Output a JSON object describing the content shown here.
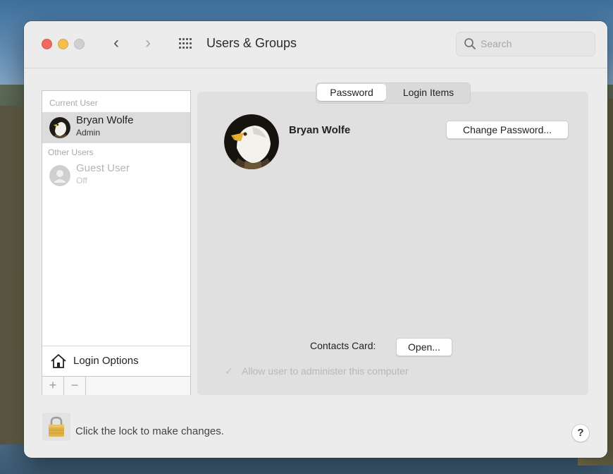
{
  "window": {
    "title": "Users & Groups",
    "search_placeholder": "Search"
  },
  "sidebar": {
    "current_user_label": "Current User",
    "current_user": {
      "name": "Bryan Wolfe",
      "role": "Admin"
    },
    "other_users_label": "Other Users",
    "other_users": [
      {
        "name": "Guest User",
        "role": "Off"
      }
    ],
    "login_options_label": "Login Options",
    "add_label": "+",
    "remove_label": "−"
  },
  "main": {
    "tabs": [
      {
        "label": "Password",
        "active": true
      },
      {
        "label": "Login Items",
        "active": false
      }
    ],
    "profile_name": "Bryan Wolfe",
    "change_password_label": "Change Password...",
    "contacts_card_label": "Contacts Card:",
    "open_label": "Open...",
    "allow_admin_label": "Allow user to administer this computer",
    "allow_admin_checked": true
  },
  "footer": {
    "lock_text": "Click the lock to make changes.",
    "help_label": "?"
  },
  "icons": {
    "back": "chevron-left-icon",
    "forward": "chevron-right-icon",
    "show_all": "grid-icon",
    "search": "search-icon",
    "login_options": "house-icon",
    "lock": "lock-icon"
  },
  "colors": {
    "close": "#ed6a5e",
    "minimize": "#f5bf4f",
    "zoom_disabled": "#d0d0d0",
    "selected_row": "#dcdcdc",
    "lock": "#e0b24a"
  }
}
